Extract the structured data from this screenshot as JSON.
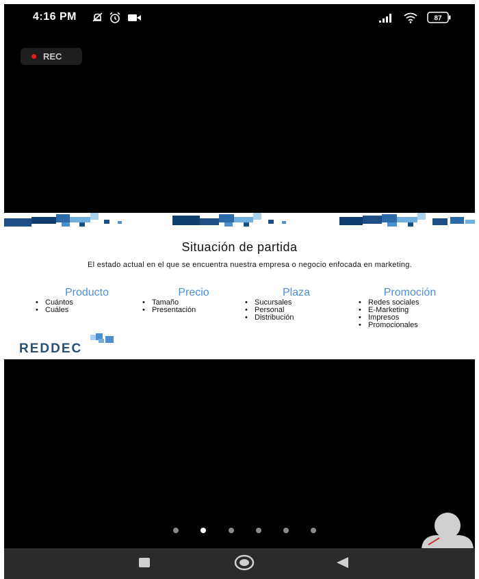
{
  "status_bar": {
    "time": "4:16 PM",
    "left_icons": [
      "notifications-muted-icon",
      "alarm-icon",
      "video-camera-icon"
    ],
    "right_icons": [
      "signal-icon",
      "wifi-icon",
      "battery-icon"
    ],
    "battery_level": "87"
  },
  "recording": {
    "label": "REC"
  },
  "slide": {
    "title": "Situación de partida",
    "description": "El estado actual en el que se encuentra nuestra empresa o negocio enfocada en marketing.",
    "columns": [
      {
        "heading": "Producto",
        "items": [
          "Cuántos",
          "Cuáles"
        ]
      },
      {
        "heading": "Precio",
        "items": [
          "Tamaño",
          "Presentación"
        ]
      },
      {
        "heading": "Plaza",
        "items": [
          "Sucursales",
          "Personal",
          "Distribución"
        ]
      },
      {
        "heading": "Promoción",
        "items": [
          "Redes sociales",
          "E-Marketing",
          "Impresos",
          "Promocionales"
        ]
      }
    ],
    "logo_text": "REDDEC",
    "accent_color": "#4f8fd0",
    "logo_color": "#2d4f73"
  },
  "pager": {
    "count": 6,
    "active_index": 1
  },
  "nav_bar": {
    "buttons": [
      "recents-button",
      "home-button",
      "back-button"
    ]
  }
}
